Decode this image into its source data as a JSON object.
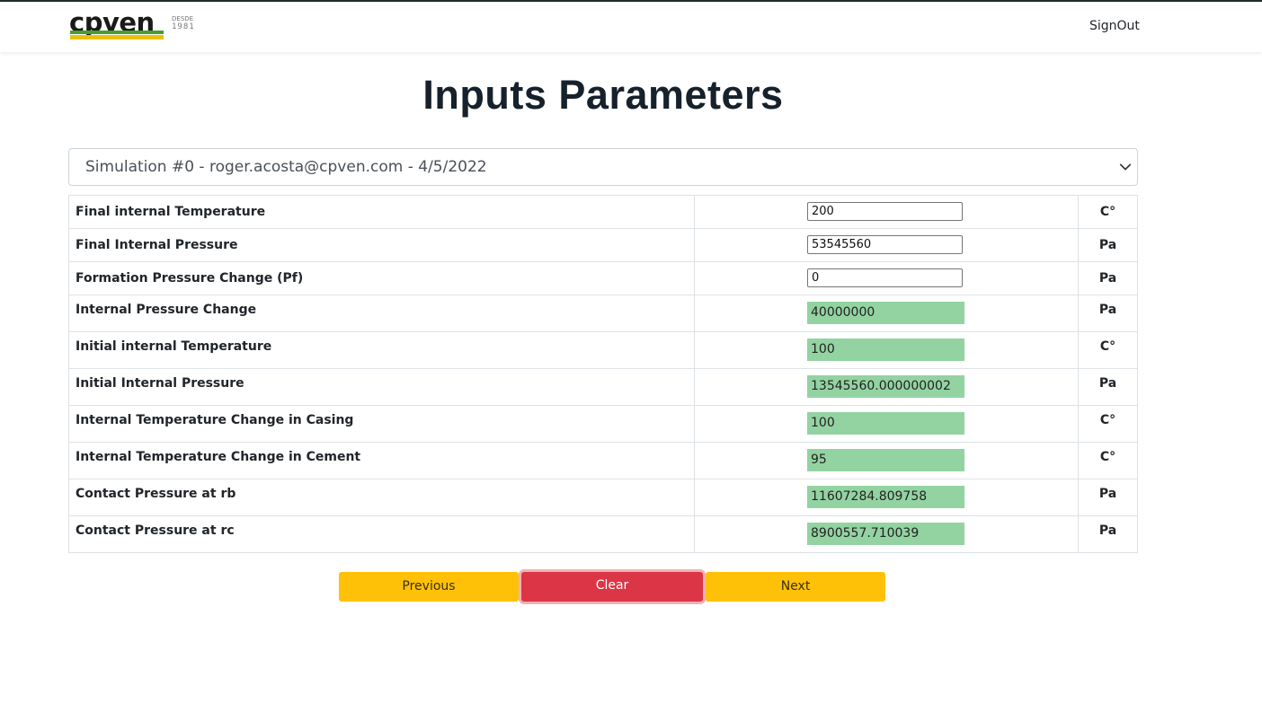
{
  "brand": {
    "logo_text": "cpven",
    "desde": "DESDE",
    "year": "1981",
    "colors": {
      "green": "#4a9d2c",
      "yellow": "#e8c20a"
    }
  },
  "nav": {
    "signout_label": "SignOut"
  },
  "page": {
    "title": "Inputs Parameters"
  },
  "simulation_select": {
    "selected": "Simulation #0 - roger.acosta@cpven.com - 4/5/2022",
    "icon": "chevron-down-icon"
  },
  "params": [
    {
      "label": "Final internal Temperature",
      "value": "200",
      "unit": "C°",
      "editable": true
    },
    {
      "label": "Final Internal Pressure",
      "value": "53545560",
      "unit": "Pa",
      "editable": true
    },
    {
      "label": "Formation Pressure Change (Pf)",
      "value": "0",
      "unit": "Pa",
      "editable": true
    },
    {
      "label": "Internal Pressure Change",
      "value": "40000000",
      "unit": "Pa",
      "editable": false
    },
    {
      "label": "Initial internal Temperature",
      "value": "100",
      "unit": "C°",
      "editable": false
    },
    {
      "label": "Initial Internal Pressure",
      "value": "13545560.000000002",
      "unit": "Pa",
      "editable": false
    },
    {
      "label": "Internal Temperature Change in Casing",
      "value": "100",
      "unit": "C°",
      "editable": false
    },
    {
      "label": "Internal Temperature Change in Cement",
      "value": "95",
      "unit": "C°",
      "editable": false
    },
    {
      "label": "Contact Pressure at rb",
      "value": "11607284.809758",
      "unit": "Pa",
      "editable": false
    },
    {
      "label": "Contact Pressure at rc",
      "value": "8900557.710039",
      "unit": "Pa",
      "editable": false
    }
  ],
  "buttons": {
    "previous": "Previous",
    "clear": "Clear",
    "next": "Next"
  },
  "colors": {
    "computed_bg": "#93d3a2",
    "warning": "#ffc107",
    "danger": "#dc3545"
  }
}
